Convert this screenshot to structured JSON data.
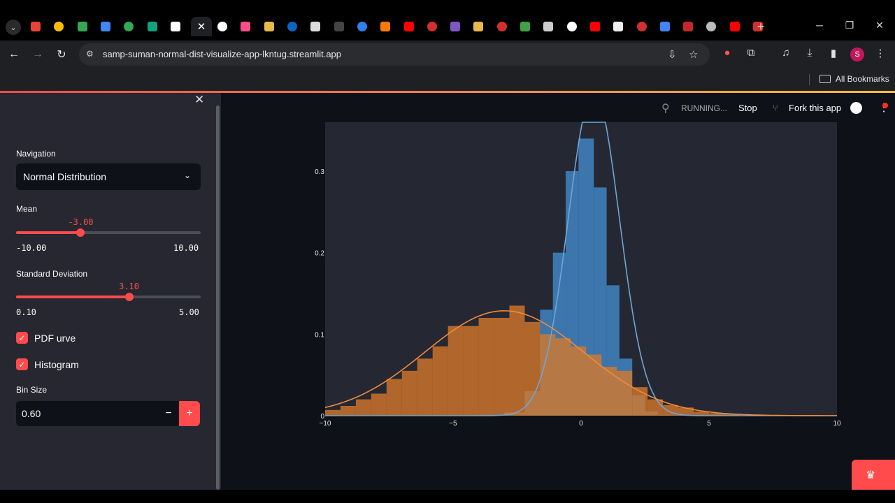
{
  "browser": {
    "url": "samp-suman-normal-dist-visualize-app-lkntug.streamlit.app",
    "bookmarks_label": "All Bookmarks",
    "profile_initial": "S",
    "tab_favicons": [
      "#ea4335",
      "#fbbc04",
      "#34a853",
      "#4285f4",
      "#34a853",
      "#10a37f",
      "#ffffff",
      "#ffffff",
      "#ff4f8b",
      "#e8b84a",
      "#0a66c2",
      "#dddddd",
      "#444444",
      "#2f80ed",
      "#ff7a00",
      "#ff0000",
      "#d32f2f",
      "#7e57c2",
      "#e8b84a",
      "#d32f2f",
      "#43a047",
      "#cccccc",
      "#ffffff",
      "#ff0000",
      "#eeeeee",
      "#d32f2f",
      "#4285f4",
      "#c62828",
      "#bbbbbb",
      "#ff0000",
      "#d32f2f"
    ]
  },
  "app": {
    "header": {
      "running": "RUNNING...",
      "stop": "Stop",
      "fork": "Fork this app"
    },
    "sidebar": {
      "navigation_label": "Navigation",
      "navigation_value": "Normal Distribution",
      "mean": {
        "label": "Mean",
        "value": "-3.00",
        "min": "-10.00",
        "max": "10.00",
        "fraction": 0.35
      },
      "std": {
        "label": "Standard Deviation",
        "value": "3.10",
        "min": "0.10",
        "max": "5.00",
        "fraction": 0.612
      },
      "pdf_checkbox": "PDF urve",
      "hist_checkbox": "Histogram",
      "bin_size_label": "Bin Size",
      "bin_size_value": "0.60"
    }
  },
  "chart_data": {
    "type": "bar",
    "xlim": [
      -10,
      10
    ],
    "ylim": [
      0,
      0.36
    ],
    "xticks": [
      "−10",
      "−5",
      "0",
      "5",
      "10"
    ],
    "yticks": [
      "0",
      "0.1",
      "0.2",
      "0.3"
    ],
    "colors": {
      "blue": "#3d7ab3",
      "orange": "#d97a29",
      "bg": "#252833"
    },
    "series": [
      {
        "bins": [
          [
            -4.2,
            -3.0,
            0.001
          ],
          [
            -3.0,
            -2.2,
            0.004
          ],
          [
            -2.2,
            -1.6,
            0.03
          ],
          [
            -1.6,
            -1.1,
            0.13
          ],
          [
            -1.1,
            -0.6,
            0.2
          ],
          [
            -0.6,
            -0.1,
            0.3
          ],
          [
            -0.1,
            0.5,
            0.34
          ],
          [
            0.5,
            1.0,
            0.28
          ],
          [
            1.0,
            1.5,
            0.16
          ],
          [
            1.5,
            2.0,
            0.07
          ],
          [
            2.0,
            2.5,
            0.025
          ],
          [
            2.5,
            3.0,
            0.005
          ],
          [
            3.0,
            4.0,
            0.001
          ]
        ],
        "pdf": {
          "mean": 0.5,
          "std": 1.0
        }
      },
      {
        "bins": [
          [
            -10,
            -9.4,
            0.007
          ],
          [
            -9.4,
            -8.8,
            0.012
          ],
          [
            -8.8,
            -8.2,
            0.02
          ],
          [
            -8.2,
            -7.6,
            0.027
          ],
          [
            -7.6,
            -7.0,
            0.045
          ],
          [
            -7.0,
            -6.4,
            0.055
          ],
          [
            -6.4,
            -5.8,
            0.07
          ],
          [
            -5.8,
            -5.2,
            0.085
          ],
          [
            -5.2,
            -4.6,
            0.11
          ],
          [
            -4.6,
            -4.0,
            0.11
          ],
          [
            -4.0,
            -3.4,
            0.12
          ],
          [
            -3.4,
            -2.8,
            0.12
          ],
          [
            -2.8,
            -2.2,
            0.135
          ],
          [
            -2.2,
            -1.6,
            0.115
          ],
          [
            -1.6,
            -1.0,
            0.1
          ],
          [
            -1.0,
            -0.4,
            0.095
          ],
          [
            -0.4,
            0.2,
            0.085
          ],
          [
            0.2,
            0.8,
            0.075
          ],
          [
            0.8,
            1.4,
            0.06
          ],
          [
            1.4,
            2.0,
            0.055
          ],
          [
            2.0,
            2.6,
            0.035
          ],
          [
            2.6,
            3.2,
            0.02
          ],
          [
            3.2,
            3.8,
            0.013
          ],
          [
            3.8,
            4.4,
            0.01
          ],
          [
            4.4,
            5.0,
            0.005
          ],
          [
            5.0,
            5.6,
            0.003
          ],
          [
            5.6,
            6.2,
            0.002
          ]
        ],
        "pdf": {
          "mean": -3.0,
          "std": 3.1
        }
      }
    ]
  }
}
